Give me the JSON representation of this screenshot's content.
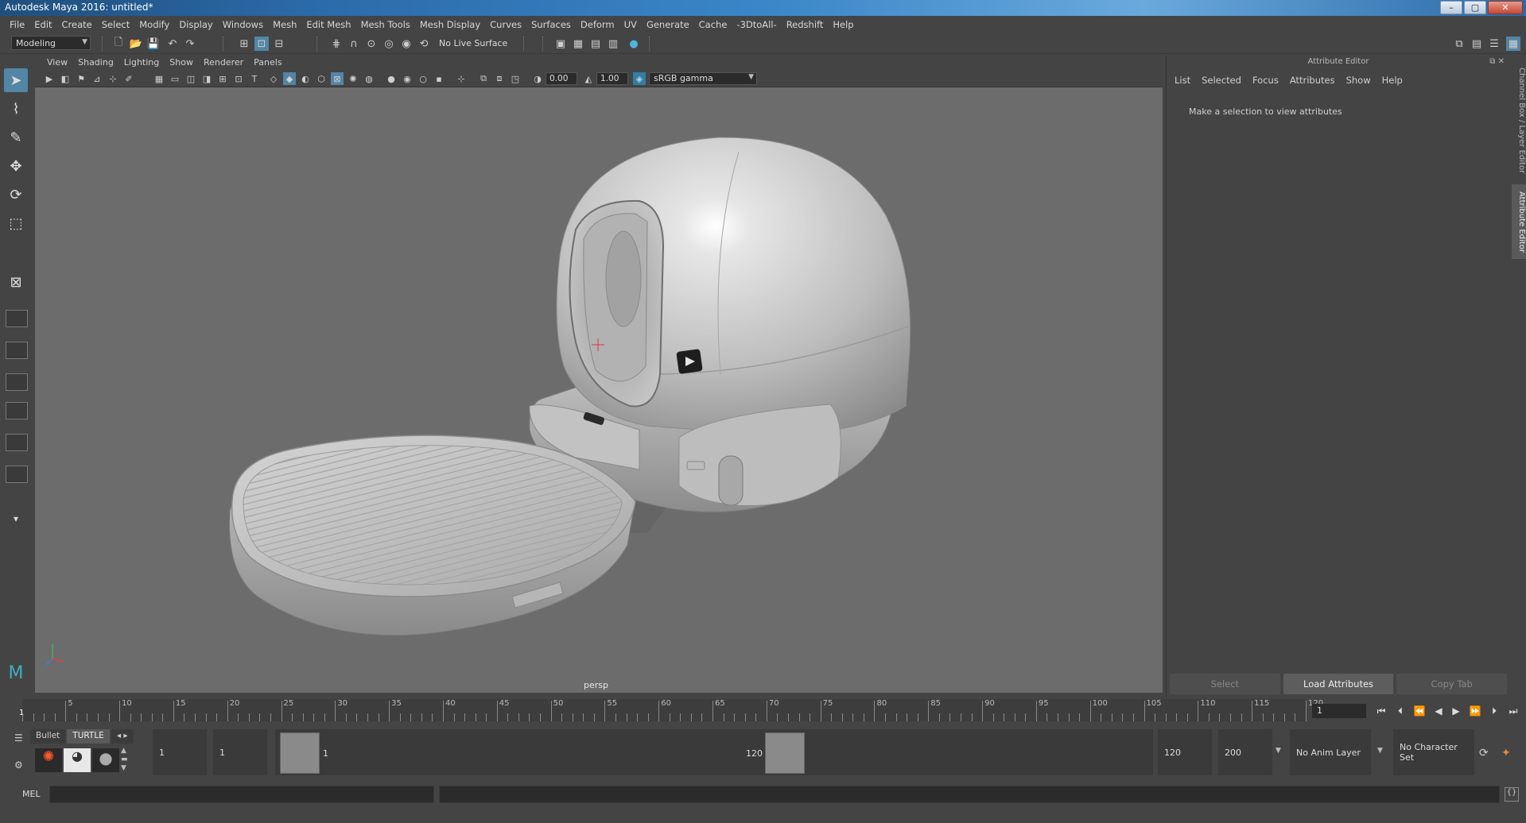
{
  "window": {
    "title": "Autodesk Maya 2016: untitled*",
    "min": "–",
    "max": "▢",
    "close": "✕"
  },
  "menubar": [
    "File",
    "Edit",
    "Create",
    "Select",
    "Modify",
    "Display",
    "Windows",
    "Mesh",
    "Edit Mesh",
    "Mesh Tools",
    "Mesh Display",
    "Curves",
    "Surfaces",
    "Deform",
    "UV",
    "Generate",
    "Cache",
    "-3DtoAll-",
    "Redshift",
    "Help"
  ],
  "status": {
    "mode": "Modeling",
    "live_surface": "No Live Surface"
  },
  "viewport": {
    "menu": [
      "View",
      "Shading",
      "Lighting",
      "Show",
      "Renderer",
      "Panels"
    ],
    "exposure": "0.00",
    "gamma": "1.00",
    "color_space": "sRGB gamma",
    "camera": "persp"
  },
  "attribute_editor": {
    "title": "Attribute Editor",
    "menu": [
      "List",
      "Selected",
      "Focus",
      "Attributes",
      "Show",
      "Help"
    ],
    "message": "Make a selection to view attributes",
    "buttons": {
      "select": "Select",
      "load": "Load Attributes",
      "copy": "Copy Tab"
    }
  },
  "side_tabs": {
    "channel_box": "Channel Box / Layer Editor",
    "attribute_editor": "Attribute Editor"
  },
  "timeline": {
    "ticks": [
      5,
      10,
      15,
      20,
      25,
      30,
      35,
      40,
      45,
      50,
      55,
      60,
      65,
      70,
      75,
      80,
      85,
      90,
      95,
      100,
      105,
      110,
      115,
      120
    ],
    "start_label": "1",
    "current_frame": "1"
  },
  "range": {
    "shelf_tabs": [
      "Bullet",
      "TURTLE"
    ],
    "start_anim": "1",
    "start_playback": "1",
    "range_start": "1",
    "range_end": "120",
    "end_playback": "120",
    "end_anim": "200",
    "anim_layer": "No Anim Layer",
    "character_set": "No Character Set"
  },
  "cmdline": {
    "label": "MEL"
  }
}
